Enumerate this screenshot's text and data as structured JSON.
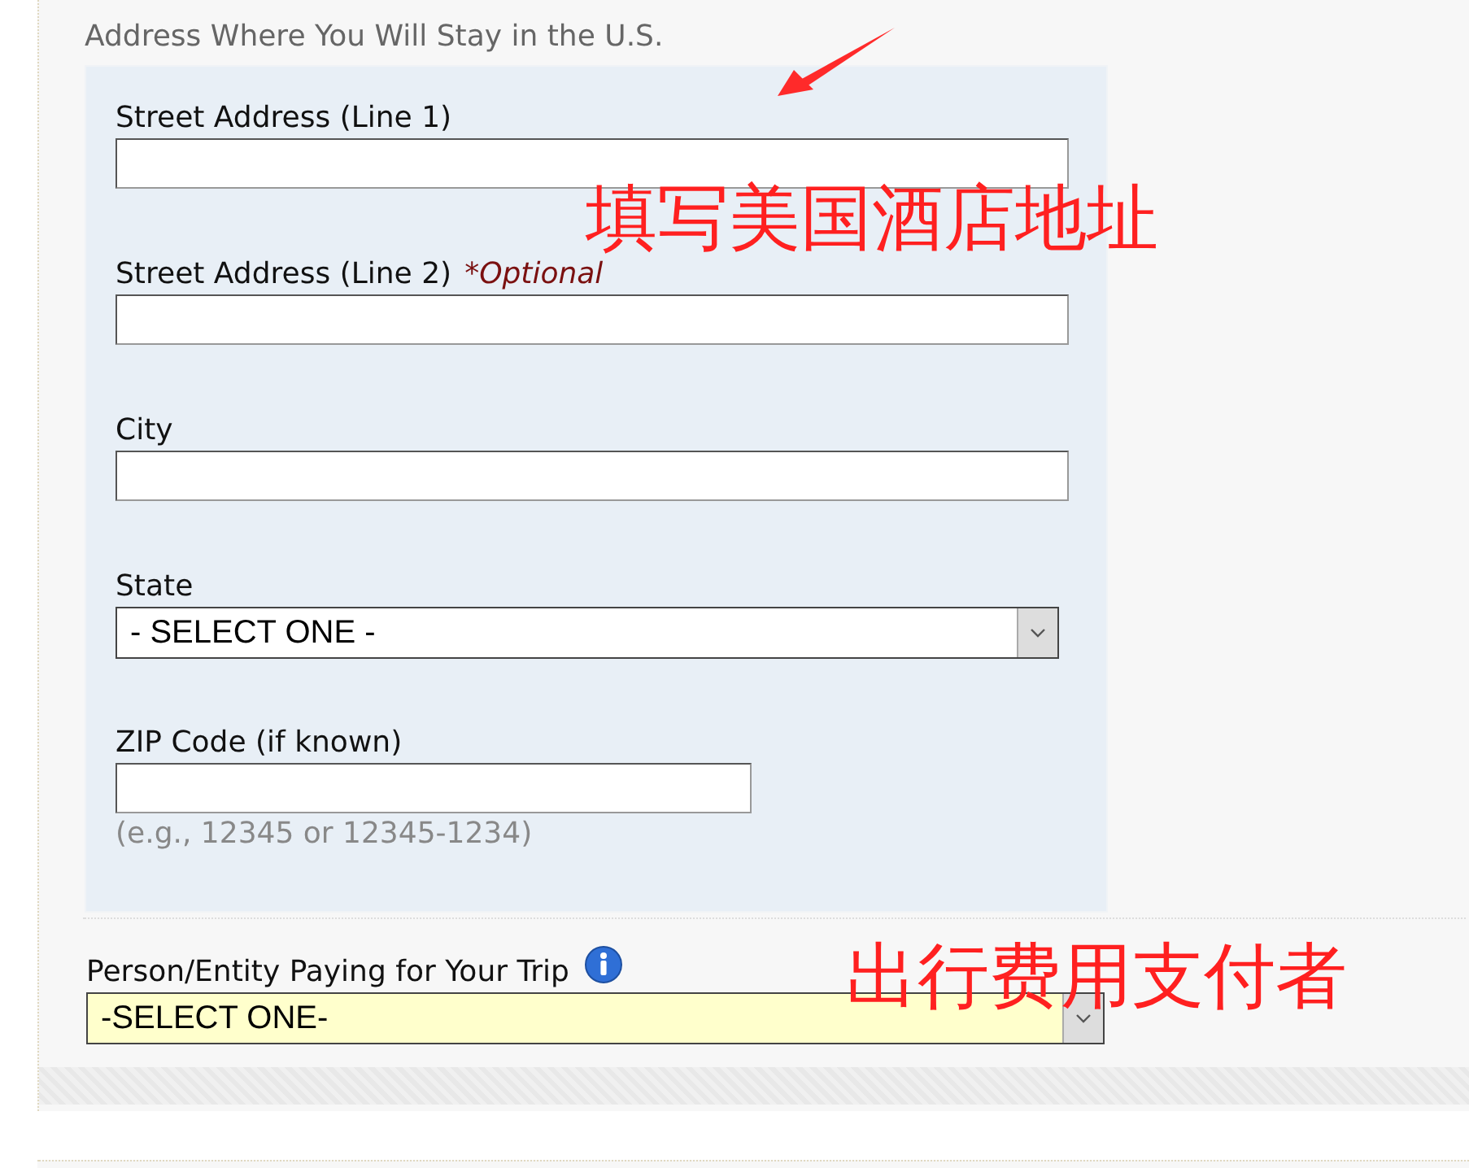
{
  "section": {
    "title": "Address Where You Will Stay in the U.S.",
    "fields": [
      {
        "kind": "text",
        "label": "Street Address (Line 1)"
      },
      {
        "kind": "text",
        "label": "Street Address (Line 2)",
        "note": "*Optional"
      },
      {
        "kind": "text",
        "label": "City"
      },
      {
        "kind": "select",
        "label": "State",
        "value": "- SELECT ONE -"
      },
      {
        "kind": "text",
        "label": "ZIP Code (if known)",
        "hint": "(e.g., 12345 or 12345-1234)"
      }
    ]
  },
  "payer": {
    "label": "Person/Entity Paying for Your Trip",
    "value": "-SELECT ONE-"
  },
  "annotations": [
    {
      "kind": "arrow"
    },
    {
      "kind": "text",
      "text": "填写美国酒店地址"
    },
    {
      "kind": "text",
      "text": "出行费用支付者"
    }
  ]
}
